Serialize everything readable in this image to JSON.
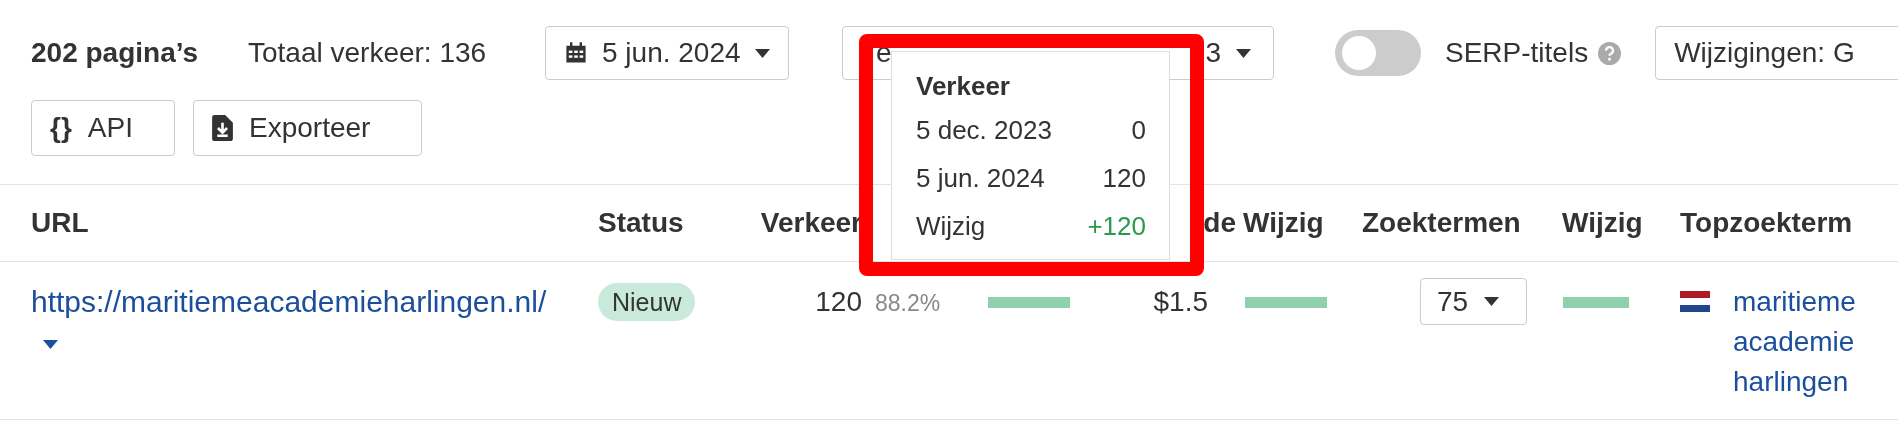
{
  "toolbar": {
    "page_count": "202 pagina’s",
    "total_traffic": "Totaal verkeer: 136",
    "date_dropdown": "5 jun. 2024",
    "compare_dropdown": {
      "text_start": "e",
      "text_end": "3"
    },
    "serp_titles_toggle": {
      "label": "SERP-titels",
      "on": false
    },
    "changes_dropdown": "Wijzigingen: G"
  },
  "actions": [
    {
      "label": "API",
      "kind": "api",
      "icon_text": "{}"
    },
    {
      "label": "Exporteer",
      "kind": "export"
    }
  ],
  "table": {
    "columns": [
      "URL",
      "Status",
      "Verkeer",
      "de",
      "Wijzig",
      "Zoektermen",
      "Wijzig",
      "Topzoekterm"
    ],
    "rows": [
      {
        "url": "https://maritiemeacademieharlingen.nl/",
        "status": "Nieuw",
        "traffic": "120",
        "traffic_share": "88.2%",
        "value": "$1.5",
        "keywords": "75",
        "top_keyword": "maritieme academie harlingen"
      }
    ]
  },
  "tooltip": {
    "title": "Verkeer",
    "rows": [
      {
        "label": "5 dec. 2023",
        "value": "0",
        "kind": "plain"
      },
      {
        "label": "5 jun. 2024",
        "value": "120",
        "kind": "plain"
      },
      {
        "label": "Wijzig",
        "value": "+120",
        "kind": "change"
      }
    ]
  },
  "highlight_frame": true
}
